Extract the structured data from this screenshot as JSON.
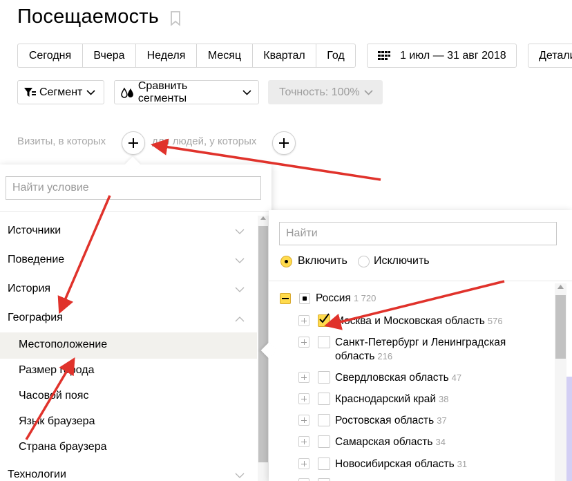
{
  "header": {
    "title": "Посещаемость"
  },
  "periods": [
    "Сегодня",
    "Вчера",
    "Неделя",
    "Месяц",
    "Квартал",
    "Год"
  ],
  "date_range": "1 июл — 31 авг 2018",
  "detail_label": "Детали",
  "segment_label": "Сегмент",
  "compare_label": "Сравнить сегменты",
  "accuracy_label": "Точность: 100%",
  "conditions": {
    "visits_label": "Визиты, в которых",
    "people_label": "для людей, у которых"
  },
  "left_panel": {
    "search_placeholder": "Найти условие",
    "categories": [
      "Источники",
      "Поведение",
      "История",
      "География"
    ],
    "geo_items": [
      "Местоположение",
      "Размер города",
      "Часовой пояс",
      "Язык браузера",
      "Страна браузера"
    ],
    "tech_label": "Технологии"
  },
  "right_panel": {
    "search_placeholder": "Найти",
    "include_label": "Включить",
    "exclude_label": "Исключить",
    "root": {
      "label": "Россия",
      "count": "1 720"
    },
    "regions": [
      {
        "line1": "Москва и Московская область",
        "line2": "",
        "count": "576",
        "checked": true
      },
      {
        "line1": "Санкт-Петербург и Ленинградская",
        "line2": "область",
        "count": "216",
        "checked": false
      },
      {
        "line1": "Свердловская область",
        "line2": "",
        "count": "47",
        "checked": false
      },
      {
        "line1": "Краснодарский край",
        "line2": "",
        "count": "38",
        "checked": false
      },
      {
        "line1": "Ростовская область",
        "line2": "",
        "count": "37",
        "checked": false
      },
      {
        "line1": "Самарская область",
        "line2": "",
        "count": "34",
        "checked": false
      },
      {
        "line1": "Новосибирская область",
        "line2": "",
        "count": "31",
        "checked": false
      }
    ]
  },
  "colors": {
    "accent": "#ffdb4d",
    "arrow": "#e0322b",
    "border": "#d6d6d6"
  }
}
